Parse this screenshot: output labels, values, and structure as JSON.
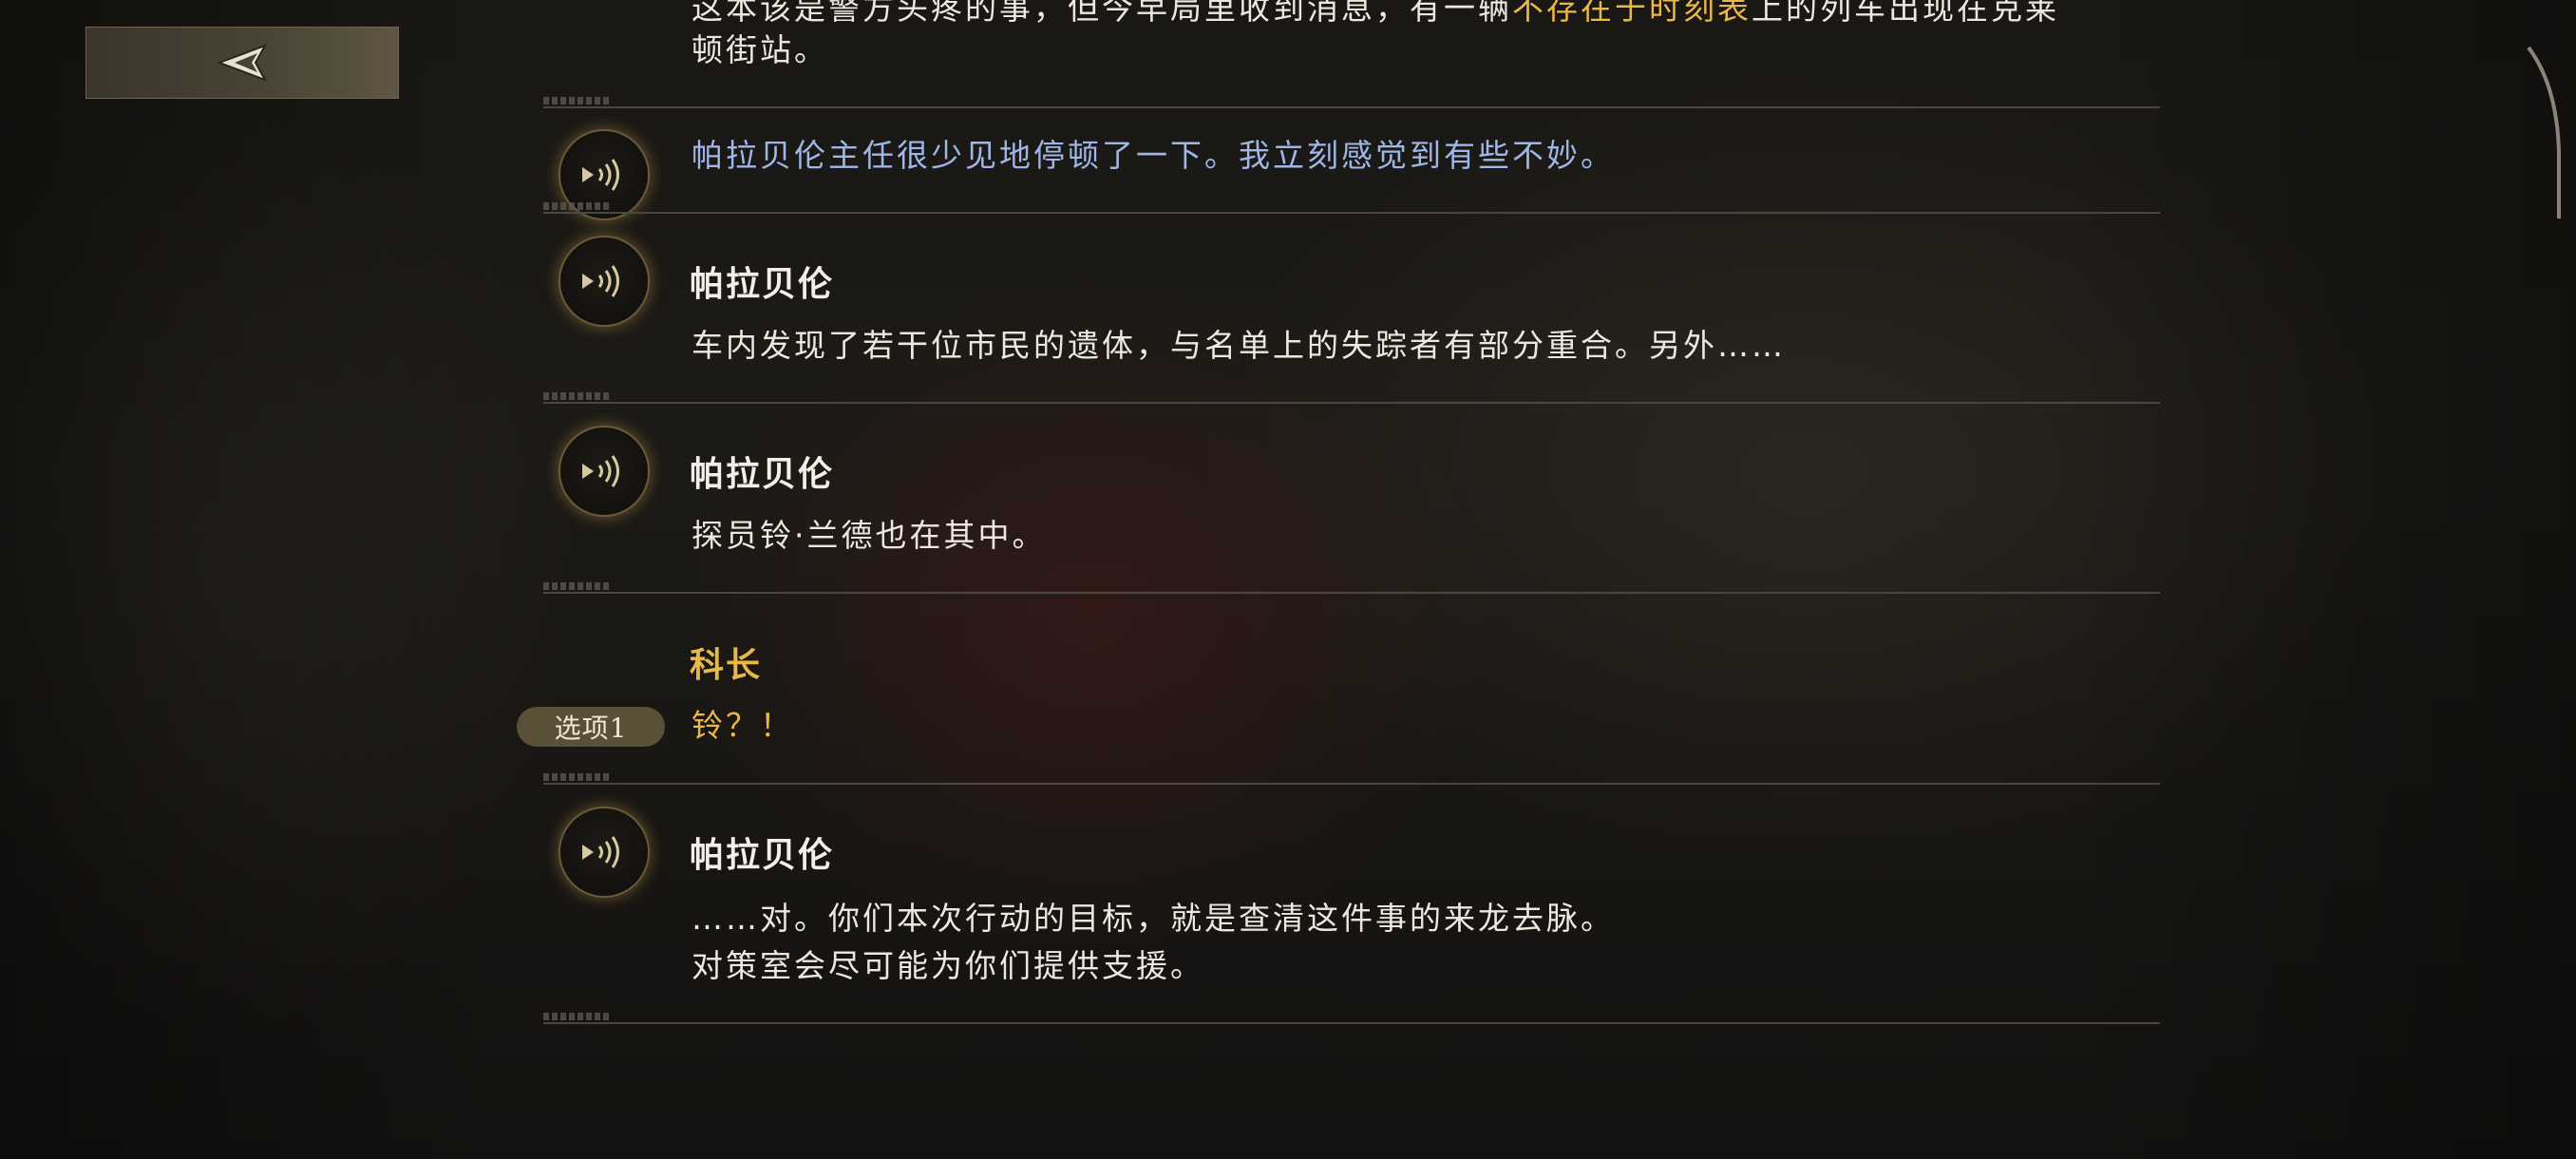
{
  "toolbar": {
    "back_label": ""
  },
  "log": {
    "entry0": {
      "line1_pre": "这本该是警方头疼的事，但今早局里收到消息，有一辆",
      "line1_highlight": "不存在于时刻表",
      "line1_post": "上的列车出现在克莱",
      "line2": "顿街站。"
    },
    "entry1": {
      "text": "帕拉贝伦主任很少见地停顿了一下。我立刻感觉到有些不妙。"
    },
    "entry2": {
      "speaker": "帕拉贝伦",
      "text": "车内发现了若干位市民的遗体，与名单上的失踪者有部分重合。另外……"
    },
    "entry3": {
      "speaker": "帕拉贝伦",
      "text": "探员铃·兰德也在其中。"
    },
    "entry4": {
      "speaker": "科长",
      "badge": "选项1",
      "text": "铃？！"
    },
    "entry5": {
      "speaker": "帕拉贝伦",
      "line1": "……对。你们本次行动的目标，就是查清这件事的来龙去脉。",
      "line2": "对策室会尽可能为你们提供支援。"
    }
  },
  "icons": {
    "back": "back-arrow-icon",
    "voice": "voice-replay-icon"
  },
  "colors": {
    "highlight": "#e8b84a",
    "narration": "#9fb6e8",
    "text": "#ece8df",
    "badge_bg": "#5a5038"
  }
}
